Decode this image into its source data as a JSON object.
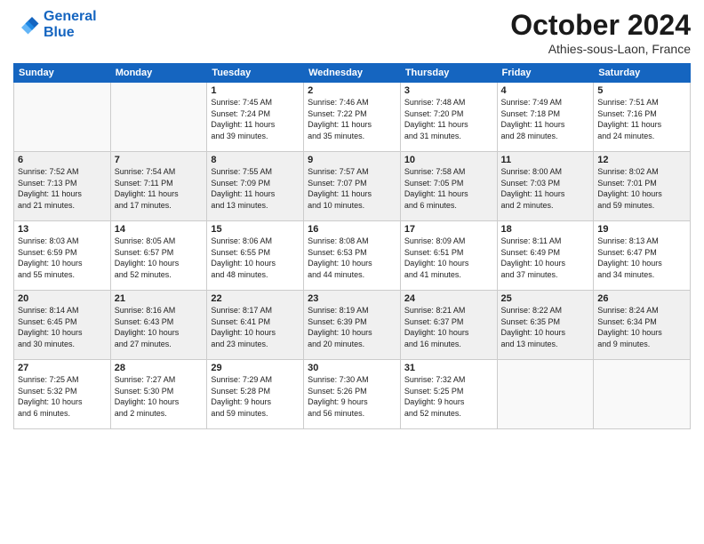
{
  "logo": {
    "line1": "General",
    "line2": "Blue"
  },
  "title": "October 2024",
  "location": "Athies-sous-Laon, France",
  "headers": [
    "Sunday",
    "Monday",
    "Tuesday",
    "Wednesday",
    "Thursday",
    "Friday",
    "Saturday"
  ],
  "weeks": [
    [
      {
        "day": "",
        "info": ""
      },
      {
        "day": "",
        "info": ""
      },
      {
        "day": "1",
        "info": "Sunrise: 7:45 AM\nSunset: 7:24 PM\nDaylight: 11 hours\nand 39 minutes."
      },
      {
        "day": "2",
        "info": "Sunrise: 7:46 AM\nSunset: 7:22 PM\nDaylight: 11 hours\nand 35 minutes."
      },
      {
        "day": "3",
        "info": "Sunrise: 7:48 AM\nSunset: 7:20 PM\nDaylight: 11 hours\nand 31 minutes."
      },
      {
        "day": "4",
        "info": "Sunrise: 7:49 AM\nSunset: 7:18 PM\nDaylight: 11 hours\nand 28 minutes."
      },
      {
        "day": "5",
        "info": "Sunrise: 7:51 AM\nSunset: 7:16 PM\nDaylight: 11 hours\nand 24 minutes."
      }
    ],
    [
      {
        "day": "6",
        "info": "Sunrise: 7:52 AM\nSunset: 7:13 PM\nDaylight: 11 hours\nand 21 minutes."
      },
      {
        "day": "7",
        "info": "Sunrise: 7:54 AM\nSunset: 7:11 PM\nDaylight: 11 hours\nand 17 minutes."
      },
      {
        "day": "8",
        "info": "Sunrise: 7:55 AM\nSunset: 7:09 PM\nDaylight: 11 hours\nand 13 minutes."
      },
      {
        "day": "9",
        "info": "Sunrise: 7:57 AM\nSunset: 7:07 PM\nDaylight: 11 hours\nand 10 minutes."
      },
      {
        "day": "10",
        "info": "Sunrise: 7:58 AM\nSunset: 7:05 PM\nDaylight: 11 hours\nand 6 minutes."
      },
      {
        "day": "11",
        "info": "Sunrise: 8:00 AM\nSunset: 7:03 PM\nDaylight: 11 hours\nand 2 minutes."
      },
      {
        "day": "12",
        "info": "Sunrise: 8:02 AM\nSunset: 7:01 PM\nDaylight: 10 hours\nand 59 minutes."
      }
    ],
    [
      {
        "day": "13",
        "info": "Sunrise: 8:03 AM\nSunset: 6:59 PM\nDaylight: 10 hours\nand 55 minutes."
      },
      {
        "day": "14",
        "info": "Sunrise: 8:05 AM\nSunset: 6:57 PM\nDaylight: 10 hours\nand 52 minutes."
      },
      {
        "day": "15",
        "info": "Sunrise: 8:06 AM\nSunset: 6:55 PM\nDaylight: 10 hours\nand 48 minutes."
      },
      {
        "day": "16",
        "info": "Sunrise: 8:08 AM\nSunset: 6:53 PM\nDaylight: 10 hours\nand 44 minutes."
      },
      {
        "day": "17",
        "info": "Sunrise: 8:09 AM\nSunset: 6:51 PM\nDaylight: 10 hours\nand 41 minutes."
      },
      {
        "day": "18",
        "info": "Sunrise: 8:11 AM\nSunset: 6:49 PM\nDaylight: 10 hours\nand 37 minutes."
      },
      {
        "day": "19",
        "info": "Sunrise: 8:13 AM\nSunset: 6:47 PM\nDaylight: 10 hours\nand 34 minutes."
      }
    ],
    [
      {
        "day": "20",
        "info": "Sunrise: 8:14 AM\nSunset: 6:45 PM\nDaylight: 10 hours\nand 30 minutes."
      },
      {
        "day": "21",
        "info": "Sunrise: 8:16 AM\nSunset: 6:43 PM\nDaylight: 10 hours\nand 27 minutes."
      },
      {
        "day": "22",
        "info": "Sunrise: 8:17 AM\nSunset: 6:41 PM\nDaylight: 10 hours\nand 23 minutes."
      },
      {
        "day": "23",
        "info": "Sunrise: 8:19 AM\nSunset: 6:39 PM\nDaylight: 10 hours\nand 20 minutes."
      },
      {
        "day": "24",
        "info": "Sunrise: 8:21 AM\nSunset: 6:37 PM\nDaylight: 10 hours\nand 16 minutes."
      },
      {
        "day": "25",
        "info": "Sunrise: 8:22 AM\nSunset: 6:35 PM\nDaylight: 10 hours\nand 13 minutes."
      },
      {
        "day": "26",
        "info": "Sunrise: 8:24 AM\nSunset: 6:34 PM\nDaylight: 10 hours\nand 9 minutes."
      }
    ],
    [
      {
        "day": "27",
        "info": "Sunrise: 7:25 AM\nSunset: 5:32 PM\nDaylight: 10 hours\nand 6 minutes."
      },
      {
        "day": "28",
        "info": "Sunrise: 7:27 AM\nSunset: 5:30 PM\nDaylight: 10 hours\nand 2 minutes."
      },
      {
        "day": "29",
        "info": "Sunrise: 7:29 AM\nSunset: 5:28 PM\nDaylight: 9 hours\nand 59 minutes."
      },
      {
        "day": "30",
        "info": "Sunrise: 7:30 AM\nSunset: 5:26 PM\nDaylight: 9 hours\nand 56 minutes."
      },
      {
        "day": "31",
        "info": "Sunrise: 7:32 AM\nSunset: 5:25 PM\nDaylight: 9 hours\nand 52 minutes."
      },
      {
        "day": "",
        "info": ""
      },
      {
        "day": "",
        "info": ""
      }
    ]
  ]
}
